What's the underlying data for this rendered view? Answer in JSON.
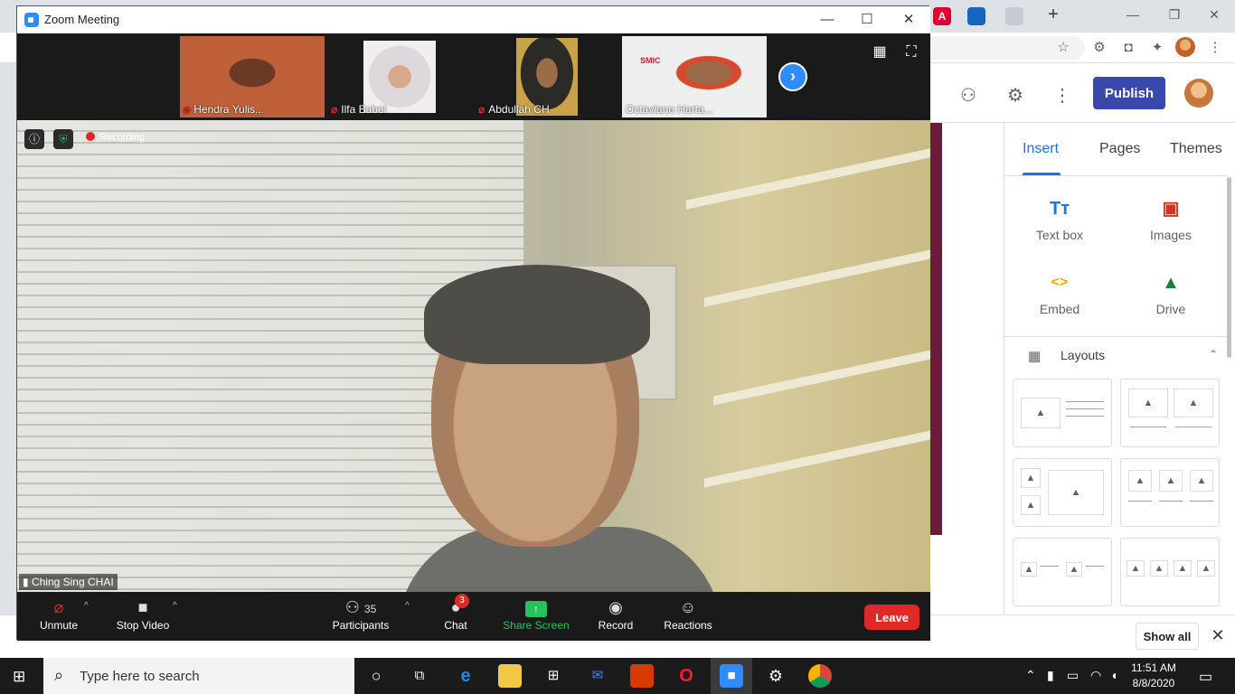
{
  "zoom": {
    "title": "Zoom Meeting",
    "participants_strip": [
      {
        "name": "Hendra Yulis..."
      },
      {
        "name": "Ilfa Babel"
      },
      {
        "name": "Abdullah CH"
      },
      {
        "name": "Octaviano Harta..."
      }
    ],
    "thumb_logo_text": "SMIC",
    "recording_label": "Recording",
    "active_speaker": "Ching Sing CHAI",
    "controls": {
      "unmute": "Unmute",
      "stop_video": "Stop Video",
      "participants": "Participants",
      "participants_count": "35",
      "chat": "Chat",
      "chat_badge": "3",
      "share_screen": "Share Screen",
      "record": "Record",
      "reactions": "Reactions",
      "leave": "Leave"
    }
  },
  "sites": {
    "publish": "Publish",
    "tabs": [
      "Insert",
      "Pages",
      "Themes"
    ],
    "insert_items": [
      {
        "label": "Text box",
        "icon": "Tт",
        "color": "#1a73e8"
      },
      {
        "label": "Images",
        "icon": "▣",
        "color": "#d93025"
      },
      {
        "label": "Embed",
        "icon": "<>",
        "color": "#f9ab00"
      },
      {
        "label": "Drive",
        "icon": "▲",
        "color": "#188038"
      }
    ],
    "layouts_label": "Layouts"
  },
  "downloads": {
    "show_all": "Show all"
  },
  "taskbar": {
    "search_placeholder": "Type here to search",
    "time": "11:51 AM",
    "date": "8/8/2020"
  },
  "colors": {
    "zoom_blue": "#2d8cff",
    "leave_red": "#e02828",
    "publish_indigo": "#3949ab",
    "share_green": "#25c25d"
  }
}
